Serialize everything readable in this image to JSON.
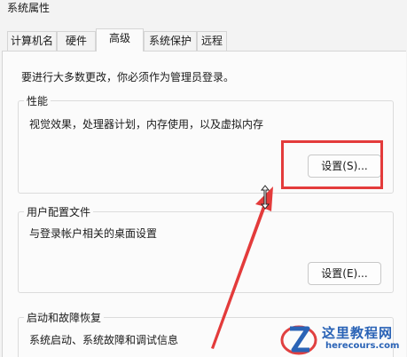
{
  "window": {
    "title": "系统属性"
  },
  "tabs": [
    {
      "label": "计算机名"
    },
    {
      "label": "硬件"
    },
    {
      "label": "高级"
    },
    {
      "label": "系统保护"
    },
    {
      "label": "远程"
    }
  ],
  "active_tab": "高级",
  "notice": "要进行大多数更改，你必须作为管理员登录。",
  "performance": {
    "title": "性能",
    "description": "视觉效果，处理器计划，内存使用，以及虚拟内存",
    "button_label": "设置(S)..."
  },
  "user_profiles": {
    "title": "用户配置文件",
    "description": "与登录帐户相关的桌面设置",
    "button_label": "设置(E)..."
  },
  "startup_recovery": {
    "title": "启动和故障恢复",
    "description": "系统启动、系统故障和调试信息"
  },
  "watermark": {
    "title": "这里教程网",
    "url": "herecours.com"
  },
  "colors": {
    "highlight": "#e33b3b",
    "watermark": "#2a63b6"
  }
}
